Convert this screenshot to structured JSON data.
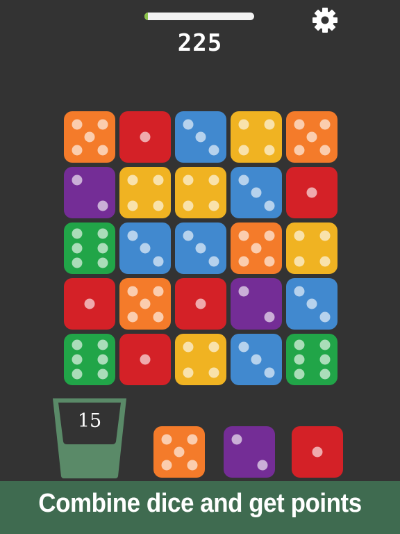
{
  "hud": {
    "score": "225",
    "progress": 0.03,
    "settings_icon": "gear-icon"
  },
  "colors": {
    "background": "#333333",
    "orange": "#f47b2a",
    "red": "#d42127",
    "blue": "#4189cf",
    "yellow": "#f0b322",
    "purple": "#742d96",
    "green": "#21a548",
    "banner": "#3f6b50",
    "cup": "#5a8a68"
  },
  "board": {
    "rows": [
      [
        {
          "color": "orange",
          "value": 5
        },
        {
          "color": "red",
          "value": 1
        },
        {
          "color": "blue",
          "value": 3
        },
        {
          "color": "yellow",
          "value": 4
        },
        {
          "color": "orange",
          "value": 5
        }
      ],
      [
        {
          "color": "purple",
          "value": 2
        },
        {
          "color": "yellow",
          "value": 4
        },
        {
          "color": "yellow",
          "value": 4
        },
        {
          "color": "blue",
          "value": 3
        },
        {
          "color": "red",
          "value": 1
        }
      ],
      [
        {
          "color": "green",
          "value": 6
        },
        {
          "color": "blue",
          "value": 3
        },
        {
          "color": "blue",
          "value": 3
        },
        {
          "color": "orange",
          "value": 5
        },
        {
          "color": "yellow",
          "value": 4
        }
      ],
      [
        {
          "color": "red",
          "value": 1
        },
        {
          "color": "orange",
          "value": 5
        },
        {
          "color": "red",
          "value": 1
        },
        {
          "color": "purple",
          "value": 2
        },
        {
          "color": "blue",
          "value": 3
        }
      ],
      [
        {
          "color": "green",
          "value": 6
        },
        {
          "color": "red",
          "value": 1
        },
        {
          "color": "yellow",
          "value": 4
        },
        {
          "color": "blue",
          "value": 3
        },
        {
          "color": "green",
          "value": 6
        }
      ]
    ]
  },
  "cup": {
    "count": "15"
  },
  "next_dice": [
    {
      "color": "orange",
      "value": 5
    },
    {
      "color": "purple",
      "value": 2
    },
    {
      "color": "red",
      "value": 1
    }
  ],
  "banner": {
    "text": "Combine dice and get points"
  }
}
